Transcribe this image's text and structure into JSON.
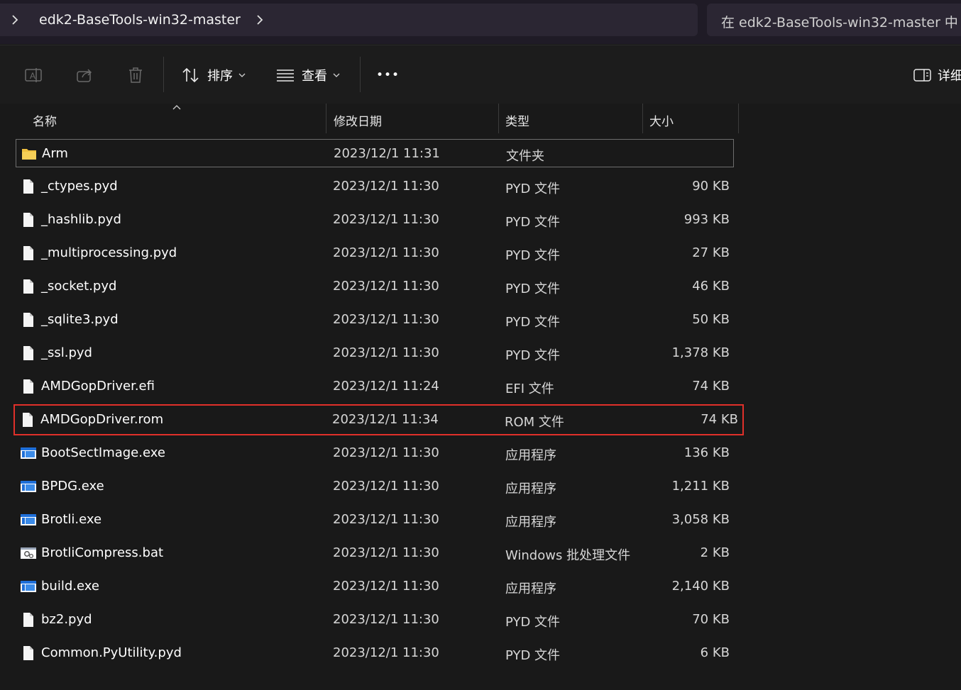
{
  "address_bar": {
    "breadcrumb": "edk2-BaseTools-win32-master",
    "left_chevron_icon": "chevron-right-icon",
    "right_chevron_icon": "chevron-right-icon"
  },
  "search": {
    "placeholder": "在 edk2-BaseTools-win32-master 中"
  },
  "toolbar": {
    "sort_label": "排序",
    "view_label": "查看",
    "more_label": "•••",
    "details_label": "详细"
  },
  "columns": {
    "name": "名称",
    "date": "修改日期",
    "type": "类型",
    "size": "大小"
  },
  "files": [
    {
      "name": "Arm",
      "date": "2023/12/1 11:31",
      "type": "文件夹",
      "size": "",
      "icon": "folder-icon"
    },
    {
      "name": "_ctypes.pyd",
      "date": "2023/12/1 11:30",
      "type": "PYD 文件",
      "size": "90 KB",
      "icon": "file-icon"
    },
    {
      "name": "_hashlib.pyd",
      "date": "2023/12/1 11:30",
      "type": "PYD 文件",
      "size": "993 KB",
      "icon": "file-icon"
    },
    {
      "name": "_multiprocessing.pyd",
      "date": "2023/12/1 11:30",
      "type": "PYD 文件",
      "size": "27 KB",
      "icon": "file-icon"
    },
    {
      "name": "_socket.pyd",
      "date": "2023/12/1 11:30",
      "type": "PYD 文件",
      "size": "46 KB",
      "icon": "file-icon"
    },
    {
      "name": "_sqlite3.pyd",
      "date": "2023/12/1 11:30",
      "type": "PYD 文件",
      "size": "50 KB",
      "icon": "file-icon"
    },
    {
      "name": "_ssl.pyd",
      "date": "2023/12/1 11:30",
      "type": "PYD 文件",
      "size": "1,378 KB",
      "icon": "file-icon"
    },
    {
      "name": "AMDGopDriver.efi",
      "date": "2023/12/1 11:24",
      "type": "EFI 文件",
      "size": "74 KB",
      "icon": "file-icon"
    },
    {
      "name": "AMDGopDriver.rom",
      "date": "2023/12/1 11:34",
      "type": "ROM 文件",
      "size": "74 KB",
      "icon": "file-icon"
    },
    {
      "name": "BootSectImage.exe",
      "date": "2023/12/1 11:30",
      "type": "应用程序",
      "size": "136 KB",
      "icon": "exe-icon"
    },
    {
      "name": "BPDG.exe",
      "date": "2023/12/1 11:30",
      "type": "应用程序",
      "size": "1,211 KB",
      "icon": "exe-icon"
    },
    {
      "name": "Brotli.exe",
      "date": "2023/12/1 11:30",
      "type": "应用程序",
      "size": "3,058 KB",
      "icon": "exe-icon"
    },
    {
      "name": "BrotliCompress.bat",
      "date": "2023/12/1 11:30",
      "type": "Windows 批处理文件",
      "size": "2 KB",
      "icon": "batch-file-icon"
    },
    {
      "name": "build.exe",
      "date": "2023/12/1 11:30",
      "type": "应用程序",
      "size": "2,140 KB",
      "icon": "exe-icon"
    },
    {
      "name": "bz2.pyd",
      "date": "2023/12/1 11:30",
      "type": "PYD 文件",
      "size": "70 KB",
      "icon": "file-icon"
    },
    {
      "name": "Common.PyUtility.pyd",
      "date": "2023/12/1 11:30",
      "type": "PYD 文件",
      "size": "6 KB",
      "icon": "file-icon"
    }
  ],
  "highlighted_file": "AMDGopDriver.rom",
  "colors": {
    "highlight_border": "#e0302a",
    "folder": "#f0c040",
    "exe_blue": "#1e6fd9"
  }
}
